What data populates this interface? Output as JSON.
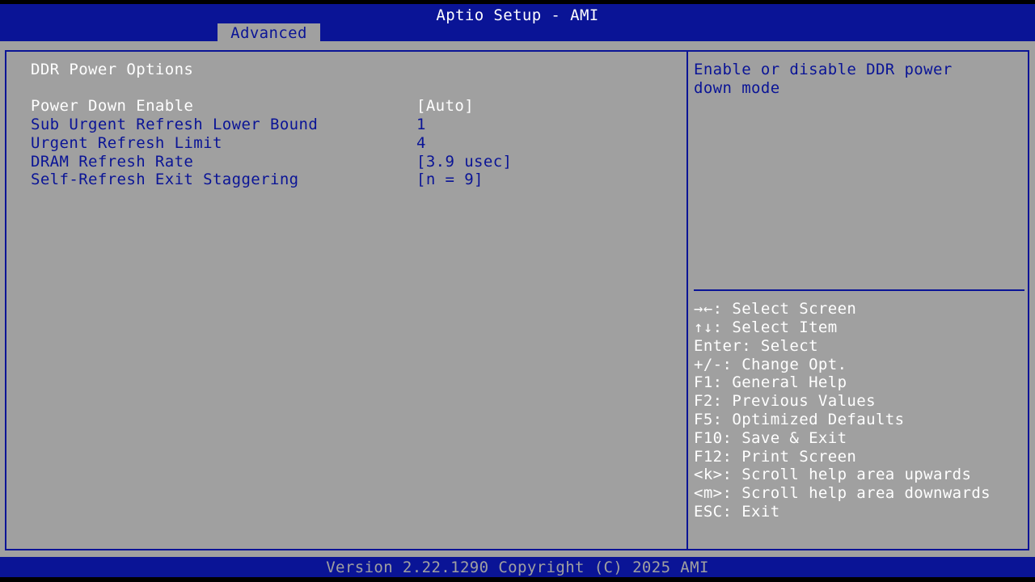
{
  "header": {
    "title": "Aptio Setup - AMI",
    "active_tab": "Advanced"
  },
  "page": {
    "section_title": "DDR Power Options",
    "rows": [
      {
        "label": "Power Down Enable",
        "value": "[Auto]",
        "selected": true
      },
      {
        "label": "Sub Urgent Refresh Lower Bound",
        "value": "1",
        "selected": false
      },
      {
        "label": "Urgent Refresh Limit",
        "value": "4",
        "selected": false
      },
      {
        "label": "DRAM Refresh Rate",
        "value": "[3.9 usec]",
        "selected": false
      },
      {
        "label": "Self-Refresh Exit Staggering",
        "value": "[n = 9]",
        "selected": false
      }
    ]
  },
  "help": {
    "text": "Enable or disable DDR power\ndown mode",
    "keys": [
      "→←: Select Screen",
      "↑↓: Select Item",
      "Enter: Select",
      "+/-: Change Opt.",
      "F1: General Help",
      "F2: Previous Values",
      "F5: Optimized Defaults",
      "F10: Save & Exit",
      "F12: Print Screen",
      "<k>: Scroll help area upwards",
      "<m>: Scroll help area downwards",
      "ESC: Exit"
    ]
  },
  "footer": {
    "version": "Version 2.22.1290 Copyright (C) 2025 AMI"
  },
  "colors": {
    "blue": "#0a1496",
    "gray": "#a0a0a0",
    "white": "#ffffff"
  }
}
